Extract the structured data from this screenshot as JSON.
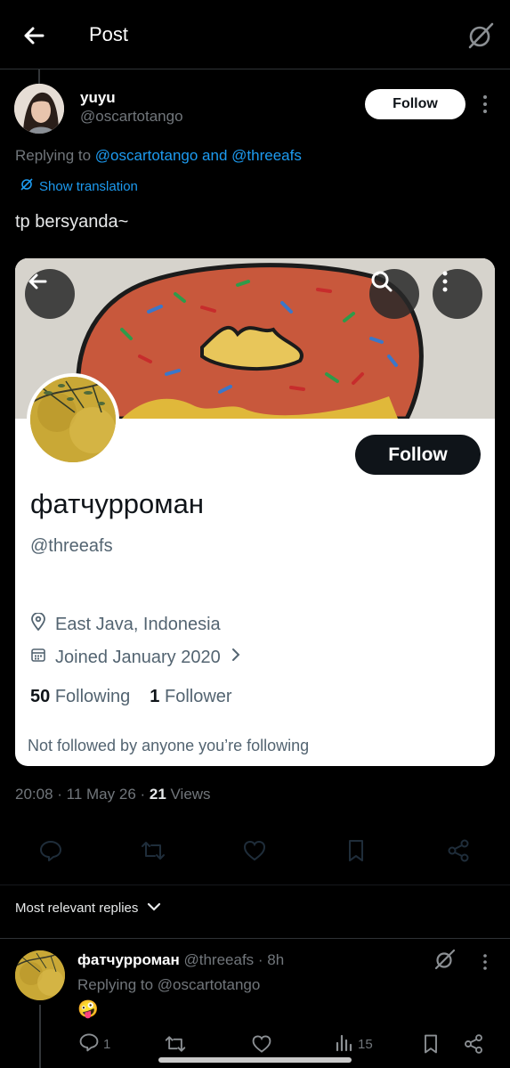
{
  "header": {
    "title": "Post"
  },
  "post": {
    "author_name": "yuyu",
    "author_handle": "@oscartotango",
    "follow_label": "Follow",
    "replying_prefix": "Replying to ",
    "replying_mentions": "@oscartotango and @threeafs",
    "translate_label": "Show translation",
    "text": "tp bersyanda~",
    "timestamp": "20:08 · 11 May 26 · ",
    "views_count": "21",
    "views_label": " Views"
  },
  "card": {
    "follow_label": "Follow",
    "name": "фатчурроман",
    "handle": "@threeafs",
    "location": "East Java, Indonesia",
    "joined": "Joined January 2020",
    "following_count": "50",
    "following_label": "Following",
    "followers_count": "1",
    "followers_label": "Follower",
    "not_followed": "Not followed by anyone you’re following"
  },
  "sort": {
    "label": "Most relevant replies"
  },
  "reply": {
    "name": "фатчурроман",
    "handle_time": " @threeafs · 8h",
    "replying": "Replying to @oscartotango",
    "emoji": "🤪",
    "reply_count": "1",
    "views_count": "15"
  },
  "colors": {
    "accent": "#1d9bf0",
    "muted": "#71767b",
    "background": "#000000",
    "text": "#e7e9ea"
  },
  "icons": [
    "back-arrow-icon",
    "grok-icon",
    "more-vertical-icon",
    "translate-icon",
    "search-icon",
    "location-icon",
    "calendar-icon",
    "chevron-right-icon",
    "reply-icon",
    "repost-icon",
    "like-icon",
    "bookmark-icon",
    "share-icon",
    "chevron-down-icon",
    "views-icon"
  ]
}
